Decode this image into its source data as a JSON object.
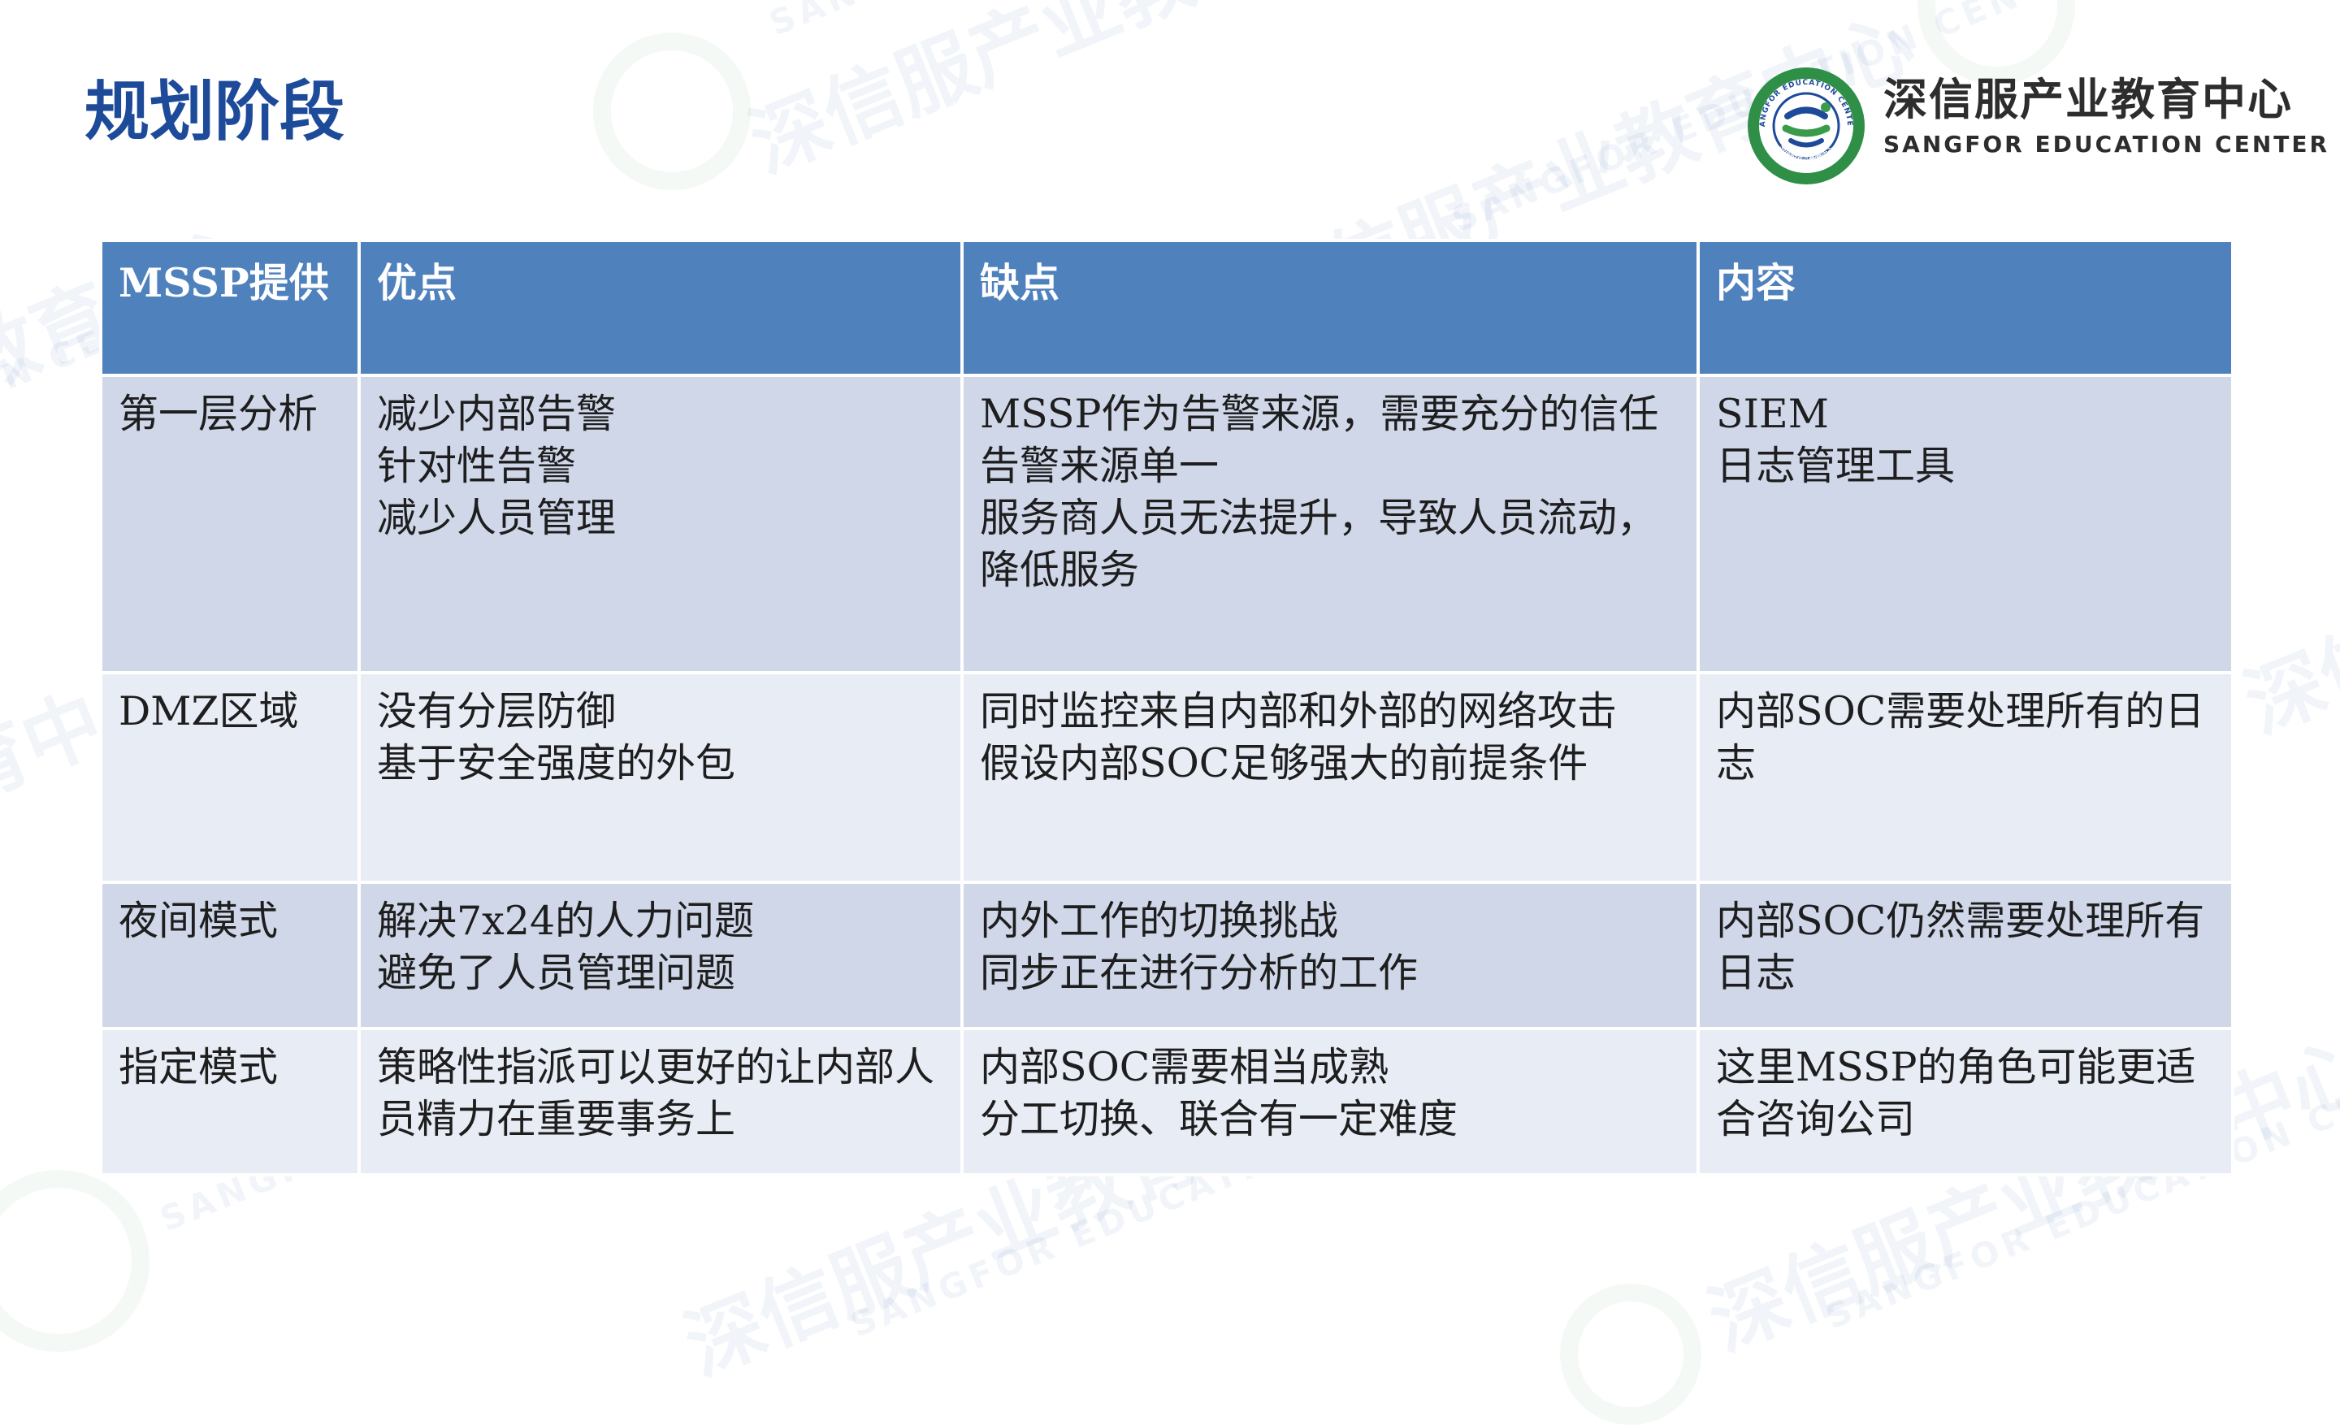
{
  "title": "规划阶段",
  "logo": {
    "name_cn": "深信服产业教育中心",
    "name_en": "SANGFOR EDUCATION CENTER",
    "ring_text": "SANGFOR EDUCATION CENTER",
    "ring_text_cn": "深信服产业教育中心",
    "colors": {
      "green": "#3a9b4a",
      "blue": "#1d4b9a",
      "ring": "#2f8f46"
    }
  },
  "watermark": {
    "text_cn": "深信服产业教育中心",
    "text_en": "SANGFOR EDUCATION CENTER"
  },
  "colors": {
    "title": "#1d4b9a",
    "header_bg": "#4f81bd",
    "row_odd_bg": "#cfd7e9",
    "row_even_bg": "#e8ecf5"
  },
  "table": {
    "headers": [
      "MSSP提供",
      "优点",
      "缺点",
      "内容"
    ],
    "rows": [
      {
        "mode": "第一层分析",
        "pros": [
          "减少内部告警",
          "针对性告警",
          "减少人员管理"
        ],
        "cons": [
          "MSSP作为告警来源，需要充分的信任",
          "告警来源单一",
          "服务商人员无法提升，导致人员流动，降低服务"
        ],
        "content": [
          "SIEM",
          "日志管理工具"
        ]
      },
      {
        "mode": "DMZ区域",
        "pros": [
          "没有分层防御",
          "基于安全强度的外包"
        ],
        "cons": [
          "同时监控来自内部和外部的网络攻击",
          "假设内部SOC足够强大的前提条件"
        ],
        "content": [
          "内部SOC需要处理所有的日志"
        ]
      },
      {
        "mode": "夜间模式",
        "pros": [
          "解决7x24的人力问题",
          "避免了人员管理问题"
        ],
        "cons": [
          "内外工作的切换挑战",
          "同步正在进行分析的工作"
        ],
        "content": [
          "内部SOC仍然需要处理所有日志"
        ]
      },
      {
        "mode": "指定模式",
        "pros": [
          "策略性指派可以更好的让内部人员精力在重要事务上"
        ],
        "cons": [
          "内部SOC需要相当成熟",
          "分工切换、联合有一定难度"
        ],
        "content": [
          "这里MSSP的角色可能更适合咨询公司"
        ]
      }
    ]
  }
}
